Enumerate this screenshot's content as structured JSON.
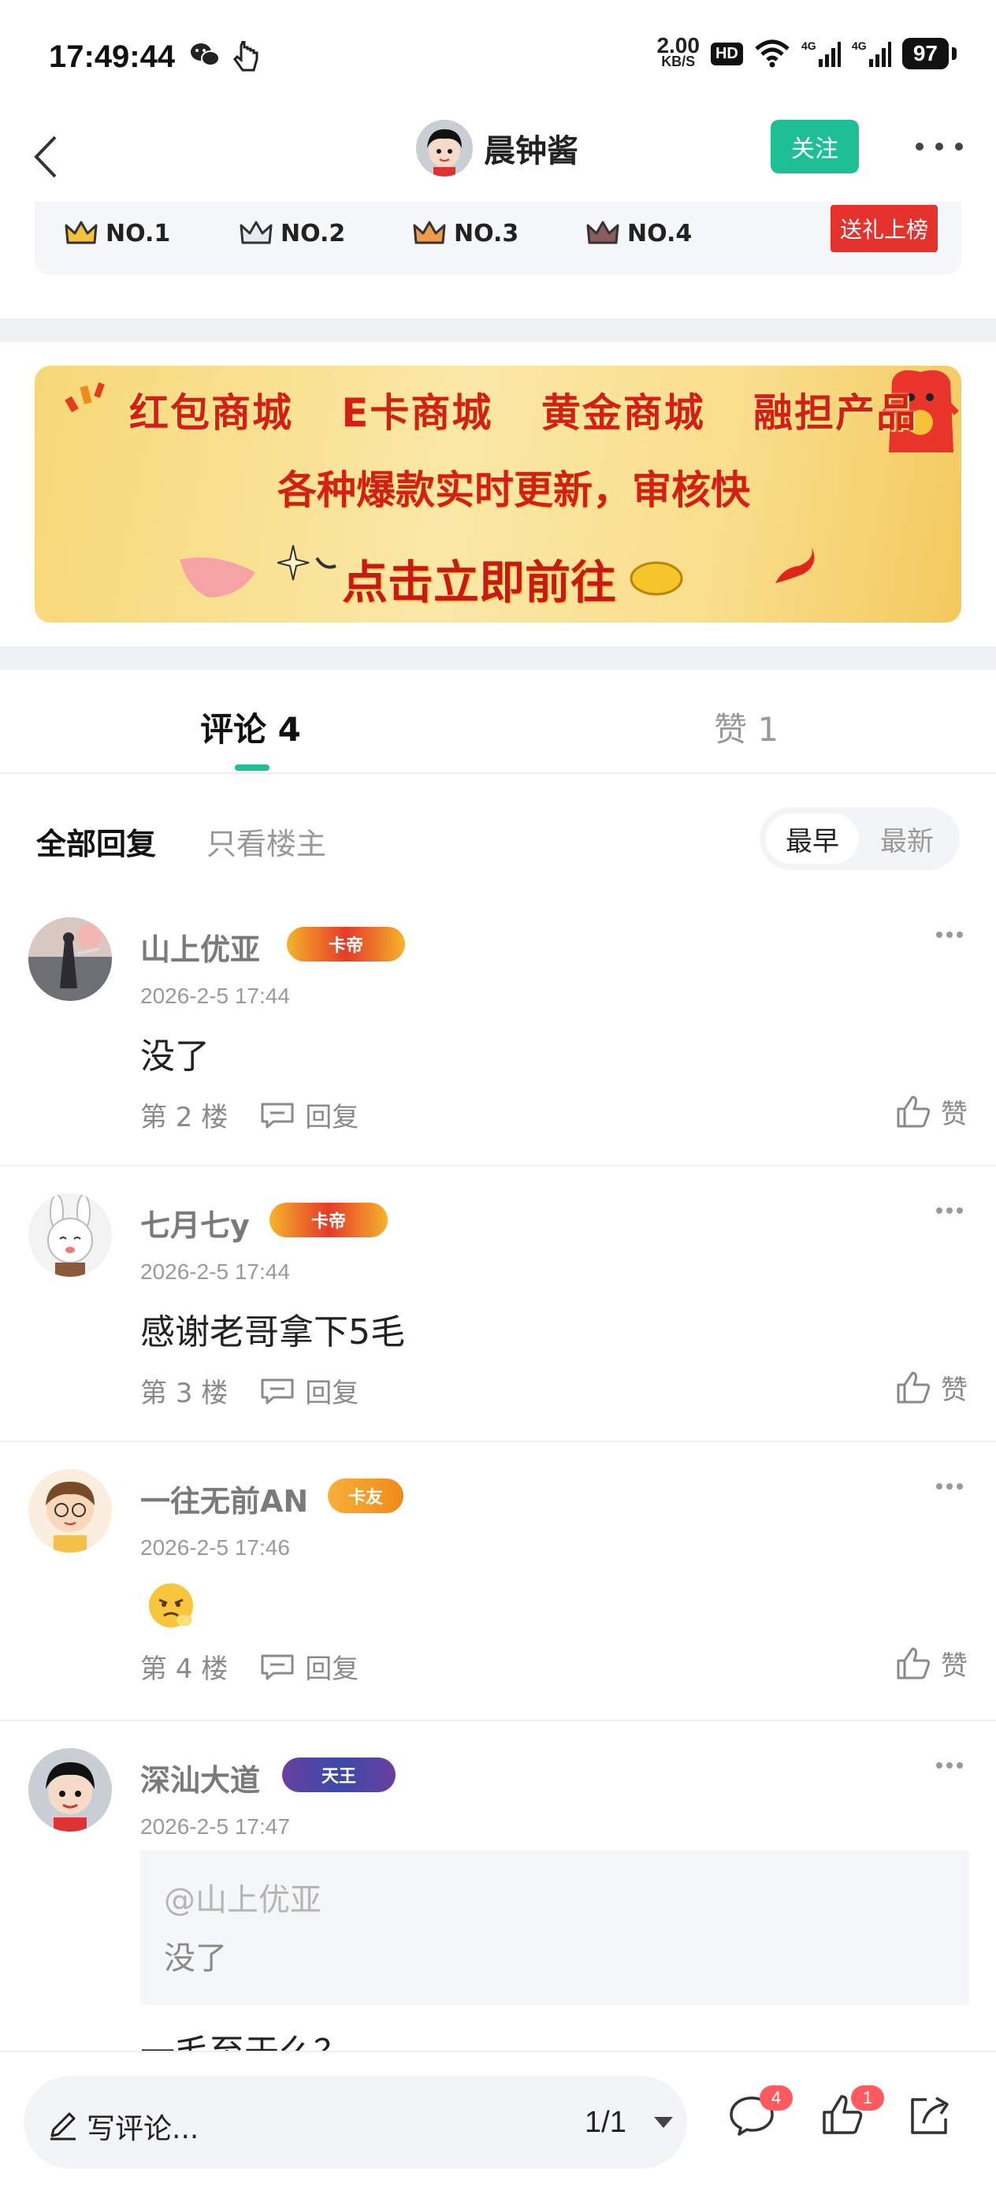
{
  "status_bar": {
    "time": "17:49:44",
    "speed_value": "2.00",
    "speed_unit": "KB/S",
    "hd_label": "HD",
    "network_1": "4G",
    "network_2": "4G",
    "battery": "97"
  },
  "nav": {
    "username": "晨钟酱",
    "follow_label": "关注"
  },
  "rank": {
    "items": [
      "NO.1",
      "NO.2",
      "NO.3",
      "NO.4"
    ],
    "gift_button": "送礼上榜"
  },
  "banner": {
    "line1": [
      "红包商城",
      "E卡商城",
      "黄金商城",
      "融担产品"
    ],
    "line2": "各种爆款实时更新，审核快",
    "cta": "点击立即前往"
  },
  "tabs": {
    "comments_label": "评论 4",
    "likes_label": "赞 1"
  },
  "filters": {
    "all_label": "全部回复",
    "owner_label": "只看楼主",
    "sort_earliest": "最早",
    "sort_latest": "最新"
  },
  "comments": [
    {
      "name": "山上优亚",
      "badge": "卡帝",
      "date": "2026-2-5 17:44",
      "text": "没了",
      "floor": "第 2 楼",
      "reply_label": "回复",
      "like_label": "赞"
    },
    {
      "name": "七月七y",
      "badge": "卡帝",
      "date": "2026-2-5 17:44",
      "text": "感谢老哥拿下5毛",
      "floor": "第 3 楼",
      "reply_label": "回复",
      "like_label": "赞"
    },
    {
      "name": "一往无前AN",
      "badge": "卡友",
      "date": "2026-2-5 17:46",
      "text": "",
      "floor": "第 4 楼",
      "reply_label": "回复",
      "like_label": "赞"
    },
    {
      "name": "深汕大道",
      "badge": "天王",
      "date": "2026-2-5 17:47",
      "quote_at": "@山上优亚",
      "quote_text": "没了",
      "text": "一毛至于么？"
    }
  ],
  "bottom_bar": {
    "write_label": "写评论...",
    "page_indicator": "1/1",
    "comment_count": "4",
    "like_count": "1"
  },
  "colors": {
    "accent": "#1fbf96",
    "gift_red": "#e5322d",
    "badge_red": "#ff5a5f"
  }
}
